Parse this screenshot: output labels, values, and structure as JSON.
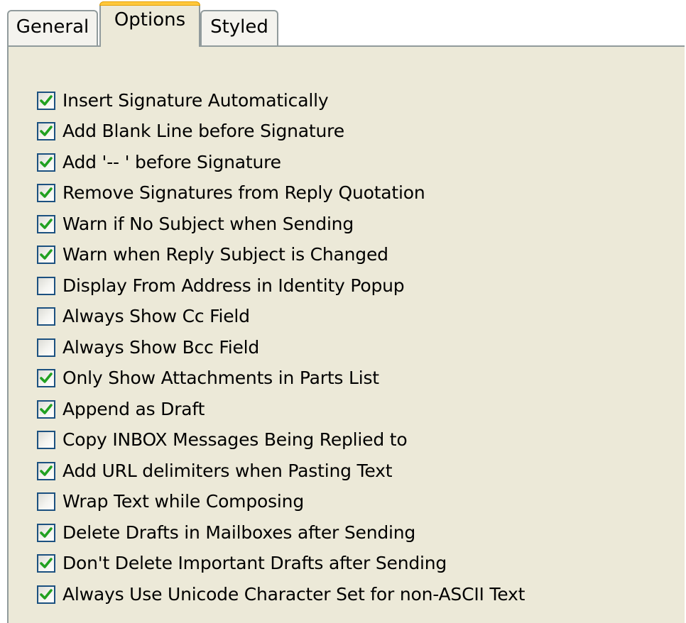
{
  "tabs": [
    {
      "label": "General",
      "active": false
    },
    {
      "label": "Options",
      "active": true
    },
    {
      "label": "Styled",
      "active": false
    }
  ],
  "options": [
    {
      "label": "Insert Signature Automatically",
      "checked": true
    },
    {
      "label": "Add Blank Line before Signature",
      "checked": true
    },
    {
      "label": "Add '-- ' before Signature",
      "checked": true
    },
    {
      "label": "Remove Signatures from Reply Quotation",
      "checked": true
    },
    {
      "label": "Warn if No Subject when Sending",
      "checked": true
    },
    {
      "label": "Warn when Reply Subject is Changed",
      "checked": true
    },
    {
      "label": "Display From Address in Identity Popup",
      "checked": false
    },
    {
      "label": "Always Show Cc Field",
      "checked": false
    },
    {
      "label": "Always Show Bcc Field",
      "checked": false
    },
    {
      "label": "Only Show Attachments in Parts List",
      "checked": true
    },
    {
      "label": "Append as Draft",
      "checked": true
    },
    {
      "label": "Copy INBOX Messages Being Replied to",
      "checked": false
    },
    {
      "label": "Add URL delimiters when Pasting Text",
      "checked": true
    },
    {
      "label": "Wrap Text while Composing",
      "checked": false
    },
    {
      "label": "Delete Drafts in Mailboxes after Sending",
      "checked": true
    },
    {
      "label": "Don't Delete Important Drafts after Sending",
      "checked": true
    },
    {
      "label": "Always Use Unicode Character Set for non-ASCII Text",
      "checked": true
    }
  ],
  "colors": {
    "panel_bg": "#ece9d8",
    "tab_hot_accent": "#ffc83c",
    "checkbox_border": "#1c5180",
    "checkmark": "#21a121"
  },
  "icons": {
    "checkmark": "checkmark-icon"
  }
}
